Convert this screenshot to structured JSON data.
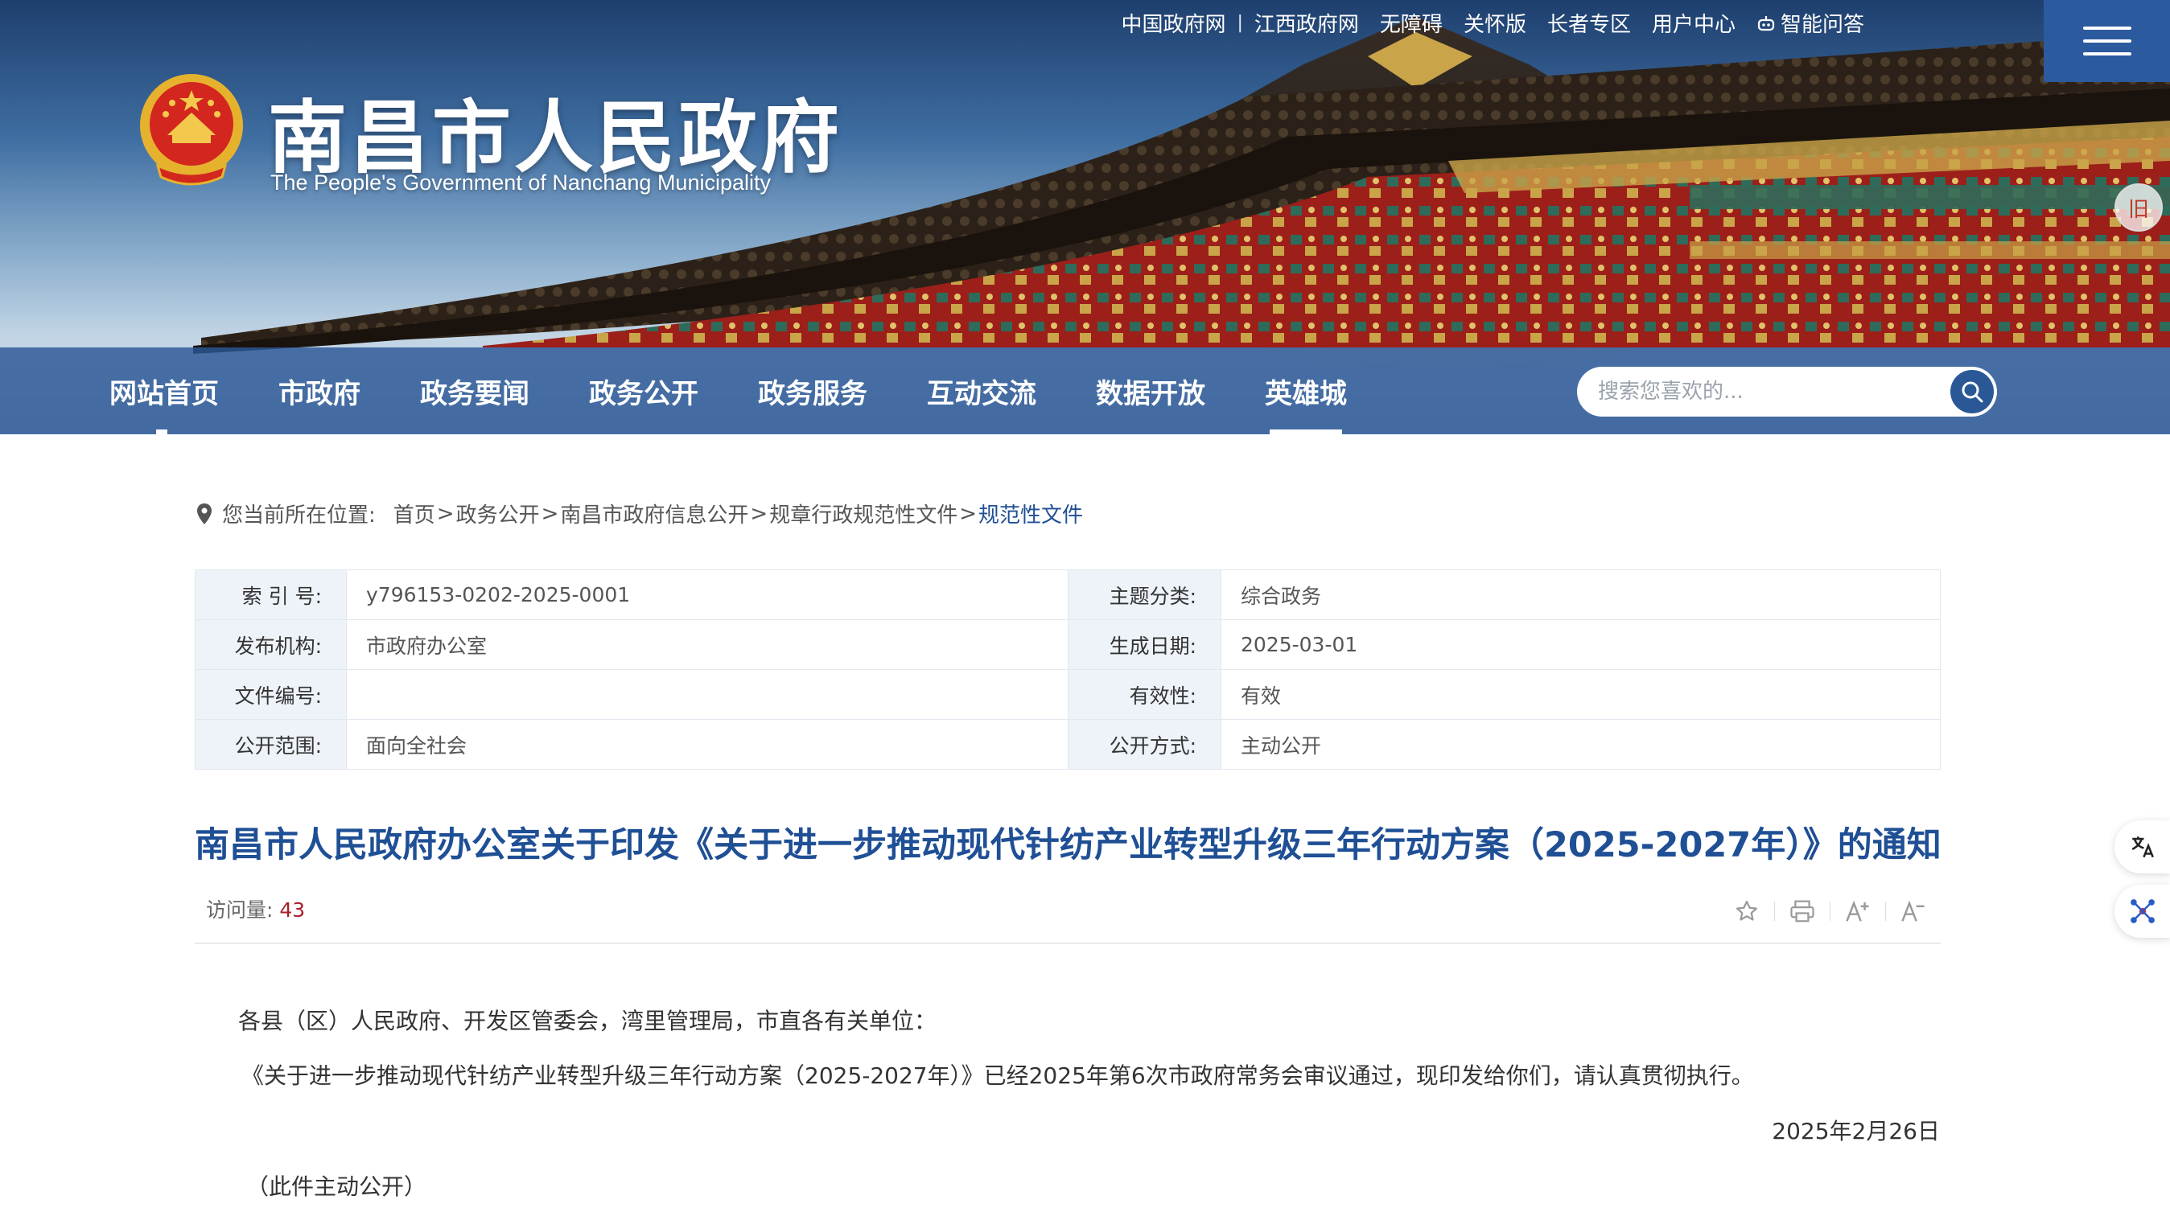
{
  "header": {
    "site_title": "南昌市人民政府",
    "site_subtitle": "The People's Government of Nanchang Municipality",
    "top_links": [
      "中国政府网",
      "江西政府网",
      "无障碍",
      "关怀版",
      "长者专区",
      "用户中心"
    ],
    "ai_link": "智能问答",
    "side_badge": "旧"
  },
  "nav": {
    "items": [
      "网站首页",
      "市政府",
      "政务要闻",
      "政务公开",
      "政务服务",
      "互动交流",
      "数据开放",
      "英雄城"
    ],
    "active_index": 7,
    "search_placeholder": "搜索您喜欢的..."
  },
  "breadcrumb": {
    "label": "您当前所在位置:",
    "items": [
      "首页",
      "政务公开",
      "南昌市政府信息公开",
      "规章行政规范性文件",
      "规范性文件"
    ],
    "separator": ">"
  },
  "meta": {
    "rows": [
      {
        "k1": "索 引 号:",
        "v1": "y796153-0202-2025-0001",
        "k2": "主题分类:",
        "v2": "综合政务"
      },
      {
        "k1": "发布机构:",
        "v1": "市政府办公室",
        "k2": "生成日期:",
        "v2": "2025-03-01"
      },
      {
        "k1": "文件编号:",
        "v1": "",
        "k2": "有效性:",
        "v2": "有效"
      },
      {
        "k1": "公开范围:",
        "v1": "面向全社会",
        "k2": "公开方式:",
        "v2": "主动公开"
      }
    ]
  },
  "article": {
    "title": "南昌市人民政府办公室关于印发《关于进一步推动现代针纺产业转型升级三年行动方案（2025-2027年）》的通知",
    "visits_label": "访问量:",
    "visits": "43",
    "body": [
      "各县（区）人民政府、开发区管委会，湾里管理局，市直各有关单位：",
      "《关于进一步推动现代针纺产业转型升级三年行动方案（2025-2027年）》已经2025年第6次市政府常务会审议通过，现印发给你们，请认真贯彻执行。",
      "2025年2月26日",
      "（此件主动公开）"
    ]
  },
  "colors": {
    "nav_bg": "#2c5896",
    "accent": "#1f4f95",
    "visits_num": "#a8202a",
    "table_key_bg": "#eef3fa"
  },
  "icons": {
    "breadcrumb": "location-pin-icon",
    "search": "search-icon",
    "tools": [
      "star-icon",
      "print-icon",
      "font-increase-icon",
      "font-decrease-icon"
    ],
    "float": [
      "translate-icon",
      "accessibility-icon"
    ],
    "menu": "hamburger-menu-icon"
  }
}
